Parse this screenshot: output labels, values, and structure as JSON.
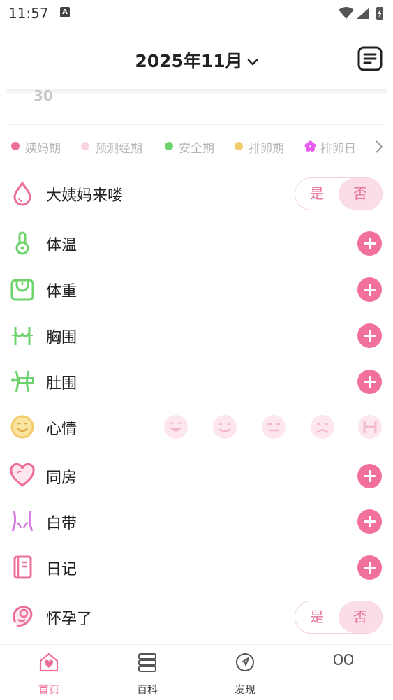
{
  "status_bar": {
    "time": "11:57",
    "notification": "A"
  },
  "header": {
    "month_title": "2025年11月"
  },
  "calendar": {
    "peek_day": "30"
  },
  "legend": [
    {
      "label": "姨妈期",
      "color": "#ee6f96"
    },
    {
      "label": "预测经期",
      "color": "#f9d4e0"
    },
    {
      "label": "安全期",
      "color": "#6ed36d"
    },
    {
      "label": "排卵期",
      "color": "#f3cc6b"
    },
    {
      "label": "排卵日",
      "color": "#e75bf0"
    }
  ],
  "records": {
    "period": {
      "label": "大姨妈来喽",
      "yes": "是",
      "no": "否"
    },
    "temperature": {
      "label": "体温"
    },
    "weight": {
      "label": "体重"
    },
    "bust": {
      "label": "胸围"
    },
    "waist": {
      "label": "肚围"
    },
    "mood": {
      "label": "心情"
    },
    "intimacy": {
      "label": "同房"
    },
    "discharge": {
      "label": "白带"
    },
    "diary": {
      "label": "日记"
    },
    "pregnant": {
      "label": "怀孕了",
      "yes": "是",
      "no": "否"
    }
  },
  "colors": {
    "accent": "#f2709c",
    "green": "#6ed36d",
    "pink_light": "#fbdde7"
  },
  "tabbar": {
    "home": "首页",
    "wiki": "百科",
    "discover": "发现"
  }
}
